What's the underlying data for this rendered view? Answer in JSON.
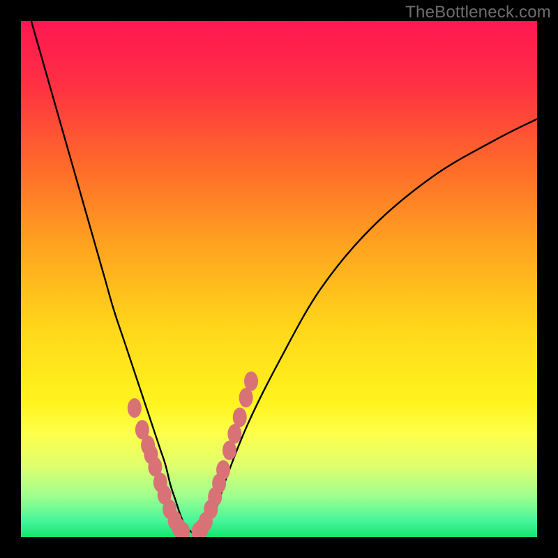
{
  "watermark": "TheBottleneck.com",
  "colors": {
    "frame": "#000000",
    "gradient_stops": [
      {
        "offset": 0.0,
        "color": "#ff1751"
      },
      {
        "offset": 0.12,
        "color": "#ff2f44"
      },
      {
        "offset": 0.28,
        "color": "#ff6a2a"
      },
      {
        "offset": 0.44,
        "color": "#ffa51f"
      },
      {
        "offset": 0.6,
        "color": "#ffd81a"
      },
      {
        "offset": 0.74,
        "color": "#fff41e"
      },
      {
        "offset": 0.8,
        "color": "#fdff4b"
      },
      {
        "offset": 0.86,
        "color": "#e0ff6c"
      },
      {
        "offset": 0.92,
        "color": "#a0ff8e"
      },
      {
        "offset": 0.97,
        "color": "#44f59a"
      },
      {
        "offset": 1.0,
        "color": "#15e56c"
      }
    ],
    "curve": "#000000",
    "markers": "#d97277"
  },
  "chart_data": {
    "type": "line",
    "title": "",
    "xlabel": "",
    "ylabel": "",
    "xlim": [
      0,
      100
    ],
    "ylim": [
      0,
      100
    ],
    "grid": false,
    "legend": false,
    "annotations": [
      "TheBottleneck.com"
    ],
    "series": [
      {
        "name": "bottleneck-curve",
        "x": [
          2,
          4,
          6,
          8,
          10,
          12,
          14,
          16,
          18,
          20,
          22,
          24,
          26,
          27,
          28,
          29,
          30,
          31,
          32,
          33,
          34,
          36,
          38,
          40,
          44,
          50,
          58,
          68,
          80,
          92,
          100
        ],
        "values": [
          100,
          93,
          86,
          79,
          72,
          65,
          58,
          51,
          44,
          38,
          32,
          26,
          20,
          17,
          14,
          10,
          7,
          4,
          2,
          1,
          0.5,
          2,
          6,
          12,
          22,
          34,
          48,
          60,
          70,
          77,
          81
        ]
      },
      {
        "name": "left-marker-cluster",
        "x": [
          22.0,
          23.5,
          24.6,
          25.2,
          26.0,
          27.0,
          27.8,
          28.8,
          29.8,
          30.6,
          31.4
        ],
        "values": [
          25.0,
          20.8,
          17.8,
          16.0,
          13.6,
          10.6,
          8.2,
          5.4,
          3.2,
          1.8,
          1.0
        ]
      },
      {
        "name": "right-marker-cluster",
        "x": [
          34.4,
          35.0,
          35.8,
          36.8,
          37.6,
          38.4,
          39.2,
          40.4,
          41.4,
          42.4,
          43.6,
          44.6
        ],
        "values": [
          1.0,
          1.6,
          3.0,
          5.4,
          7.8,
          10.4,
          13.0,
          16.8,
          20.0,
          23.2,
          27.0,
          30.2
        ]
      }
    ]
  }
}
